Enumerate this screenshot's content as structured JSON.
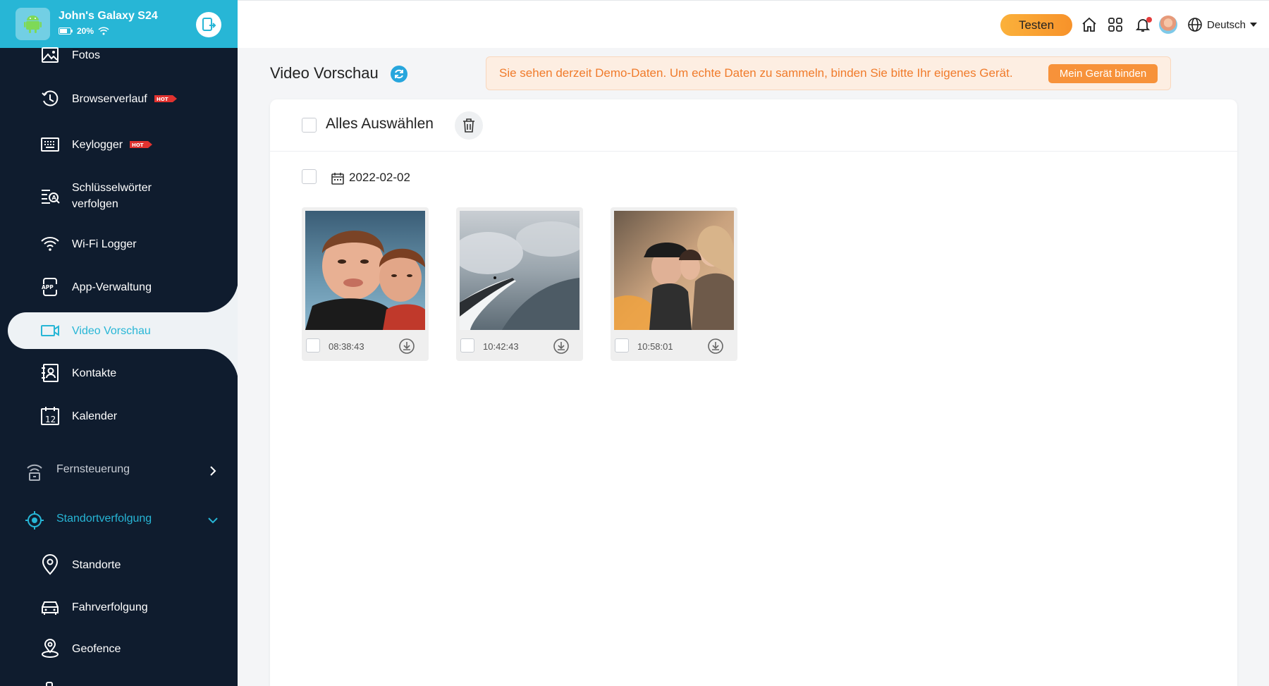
{
  "device": {
    "name": "John's Galaxy S24",
    "battery": "20%"
  },
  "sidebar": {
    "items": [
      {
        "label": "Fotos",
        "icon": "image-icon"
      },
      {
        "label": "Browserverlauf",
        "icon": "history-icon",
        "badge": "HOT"
      },
      {
        "label": "Keylogger",
        "icon": "keyboard-icon",
        "badge": "HOT"
      },
      {
        "label": "Schlüsselwörter verfolgen",
        "icon": "keyword-search-icon"
      },
      {
        "label": "Wi-Fi Logger",
        "icon": "wifi-icon"
      },
      {
        "label": "App-Verwaltung",
        "icon": "app-icon"
      },
      {
        "label": "Video Vorschau",
        "icon": "video-icon",
        "active": true
      },
      {
        "label": "Kontakte",
        "icon": "contacts-icon"
      },
      {
        "label": "Kalender",
        "icon": "calendar-icon"
      }
    ],
    "groups": [
      {
        "label": "Fernsteuerung",
        "icon": "remote-control-icon",
        "expanded": false
      },
      {
        "label": "Standortverfolgung",
        "icon": "location-target-icon",
        "expanded": true
      }
    ],
    "sub_items": [
      {
        "label": "Standorte",
        "icon": "location-pin-icon"
      },
      {
        "label": "Fahrverfolgung",
        "icon": "car-icon"
      },
      {
        "label": "Geofence",
        "icon": "geofence-icon"
      }
    ]
  },
  "topbar": {
    "test_label": "Testen",
    "language": "Deutsch"
  },
  "main": {
    "title": "Video Vorschau",
    "banner_text": "Sie sehen derzeit Demo-Daten. Um echte Daten zu sammeln, binden Sie bitte Ihr eigenes Gerät.",
    "bind_button": "Mein Gerät binden",
    "select_all": "Alles Auswählen",
    "date": "2022-02-02",
    "videos": [
      {
        "time": "08:38:43"
      },
      {
        "time": "10:42:43"
      },
      {
        "time": "10:58:01"
      }
    ]
  },
  "colors": {
    "sidebar_bg": "#0f1c2e",
    "accent": "#27b6d6",
    "banner_text": "#f07b2b",
    "test_button": "#f7922a"
  }
}
